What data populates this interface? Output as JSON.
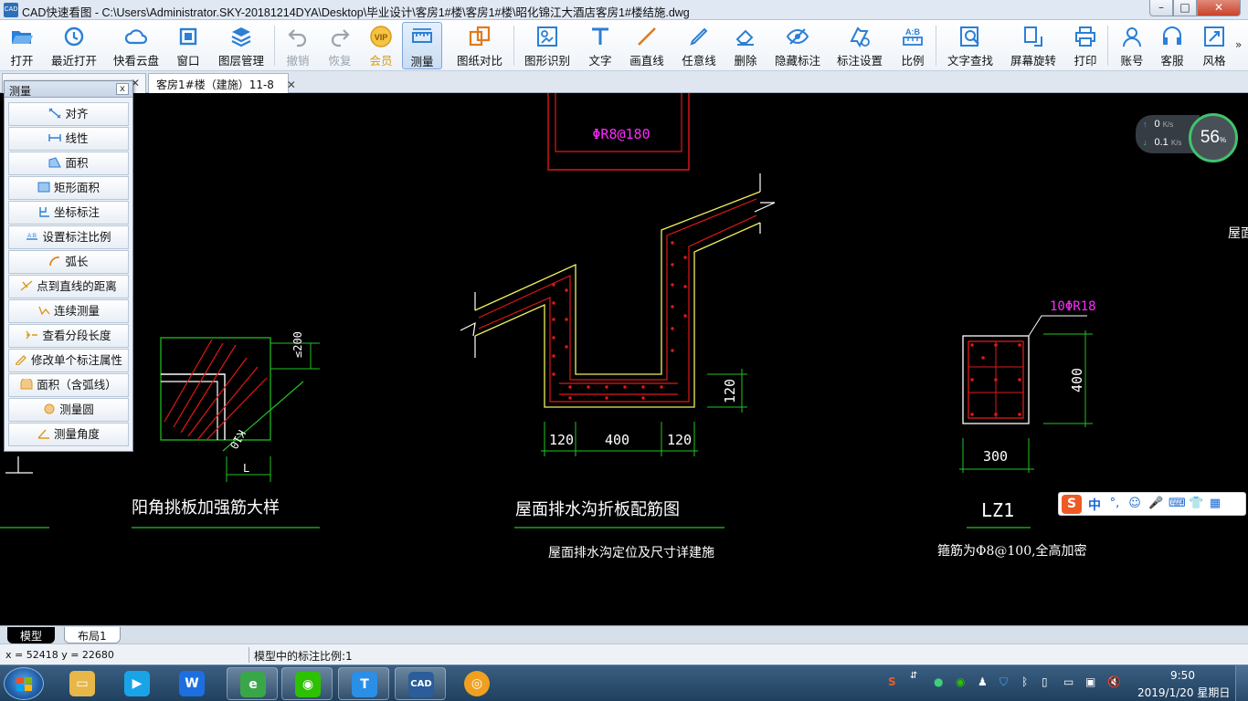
{
  "window": {
    "title": "CAD快速看图 - C:\\Users\\Administrator.SKY-20181214DYA\\Desktop\\毕业设计\\客房1#楼\\客房1#楼\\昭化锦江大酒店客房1#楼结施.dwg",
    "app_icon": "CAD",
    "minimize": "–",
    "maximize": "□",
    "close": "✕"
  },
  "toolbar": {
    "items": [
      {
        "label": "打开",
        "icon": "folder-open-icon",
        "color": "#2b7fd6"
      },
      {
        "label": "最近打开",
        "icon": "history-icon",
        "color": "#2b7fd6"
      },
      {
        "label": "快看云盘",
        "icon": "cloud-icon",
        "color": "#2b7fd6"
      },
      {
        "label": "窗口",
        "icon": "window-icon",
        "color": "#2b7fd6"
      },
      {
        "label": "图层管理",
        "icon": "layers-icon",
        "color": "#2b7fd6"
      },
      {
        "label": "撤销",
        "icon": "undo-icon",
        "color": "#9aa3ad"
      },
      {
        "label": "恢复",
        "icon": "redo-icon",
        "color": "#9aa3ad"
      },
      {
        "label": "会员",
        "icon": "vip-icon",
        "color": "#d99a1c"
      },
      {
        "label": "测量",
        "icon": "ruler-icon",
        "color": "#2b7fd6"
      },
      {
        "label": "图纸对比",
        "icon": "compare-icon",
        "color": "#e07b1a"
      },
      {
        "label": "图形识别",
        "icon": "shape-recognize-icon",
        "color": "#2b7fd6"
      },
      {
        "label": "文字",
        "icon": "text-icon",
        "color": "#2b7fd6"
      },
      {
        "label": "画直线",
        "icon": "line-icon",
        "color": "#e07b1a"
      },
      {
        "label": "任意线",
        "icon": "pen-icon",
        "color": "#2b7fd6"
      },
      {
        "label": "删除",
        "icon": "eraser-icon",
        "color": "#2b7fd6"
      },
      {
        "label": "隐藏标注",
        "icon": "hide-eye-icon",
        "color": "#2b7fd6"
      },
      {
        "label": "标注设置",
        "icon": "annotation-settings-icon",
        "color": "#2b7fd6"
      },
      {
        "label": "比例",
        "icon": "scale-icon",
        "color": "#2b7fd6"
      },
      {
        "label": "文字查找",
        "icon": "text-search-icon",
        "color": "#2b7fd6"
      },
      {
        "label": "屏幕旋转",
        "icon": "rotate-screen-icon",
        "color": "#2b7fd6"
      },
      {
        "label": "打印",
        "icon": "printer-icon",
        "color": "#2b7fd6"
      },
      {
        "label": "账号",
        "icon": "user-icon",
        "color": "#2b7fd6"
      },
      {
        "label": "客服",
        "icon": "headset-icon",
        "color": "#2b7fd6"
      },
      {
        "label": "风格",
        "icon": "style-icon",
        "color": "#2b7fd6"
      }
    ],
    "more": "»"
  },
  "doc_tabs": [
    {
      "label": "",
      "close": "✕"
    },
    {
      "label": "客房1#楼（建施）11-8",
      "close": "✕"
    }
  ],
  "measure_panel": {
    "title": "测量",
    "close": "x",
    "items": [
      {
        "label": "对齐",
        "icon": "align-measure-icon"
      },
      {
        "label": "线性",
        "icon": "linear-measure-icon"
      },
      {
        "label": "面积",
        "icon": "area-icon"
      },
      {
        "label": "矩形面积",
        "icon": "rect-area-icon"
      },
      {
        "label": "坐标标注",
        "icon": "coordinate-icon"
      },
      {
        "label": "设置标注比例",
        "icon": "set-scale-icon"
      },
      {
        "label": "弧长",
        "icon": "arc-length-icon"
      },
      {
        "label": "点到直线的距离",
        "icon": "point-line-distance-icon"
      },
      {
        "label": "连续测量",
        "icon": "continuous-measure-icon"
      },
      {
        "label": "查看分段长度",
        "icon": "segment-length-icon"
      },
      {
        "label": "修改单个标注属性",
        "icon": "edit-annotation-icon"
      },
      {
        "label": "面积（含弧线）",
        "icon": "arc-area-icon"
      },
      {
        "label": "测量圆",
        "icon": "circle-measure-icon"
      },
      {
        "label": "测量角度",
        "icon": "angle-measure-icon"
      }
    ]
  },
  "drawing": {
    "top_rebar_label": "ΦR8@180",
    "detail1_title": "阳角挑板加强筋大样",
    "detail1_dim_200": "≤200",
    "detail1_label_k": "K10",
    "detail1_dim_l": "L",
    "detail2_title": "屋面排水沟折板配筋图",
    "detail2_subtitle": "屋面排水沟定位及尺寸详建施",
    "detail2_dims": [
      "120",
      "400",
      "120"
    ],
    "detail2_dim_v": "120",
    "lz1_title": "LZ1",
    "lz1_rebar": "10ΦR18",
    "lz1_width": "300",
    "lz1_height": "400",
    "lz1_note": "箍筋为Φ8@100,全高加密",
    "right_edge_text": "屋面"
  },
  "network": {
    "upload": "0",
    "upload_unit": "K/s",
    "download": "0.1",
    "download_unit": "K/s",
    "percent": "56",
    "percent_sign": "%"
  },
  "ime": {
    "logo": "S",
    "lang": "中",
    "punct": "°,",
    "emoji": "☺",
    "mic": "🎤",
    "keyboard": "⌨",
    "skin": "👕",
    "grid": "▦"
  },
  "model_tabs": [
    {
      "label": "模型",
      "active": true
    },
    {
      "label": "布局1",
      "active": false
    }
  ],
  "statusbar": {
    "coords": "x = 52418  y = 22680",
    "scale": "模型中的标注比例:1"
  },
  "taskbar": {
    "apps": [
      {
        "name": "explorer",
        "icon": "folder-icon",
        "color": "#e7b74a",
        "glyph": "▭"
      },
      {
        "name": "video",
        "icon": "video-player-icon",
        "color": "#1aa4e8",
        "glyph": "▶"
      },
      {
        "name": "wps",
        "icon": "wps-icon",
        "color": "#1d6fe0",
        "glyph": "W"
      },
      {
        "name": "ie",
        "icon": "browser-icon",
        "color": "#3aa64a",
        "glyph": "e"
      },
      {
        "name": "wechat",
        "icon": "wechat-icon",
        "color": "#2dc100",
        "glyph": "◉"
      },
      {
        "name": "t-app",
        "icon": "t-app-icon",
        "color": "#2b8fe6",
        "glyph": "T"
      },
      {
        "name": "cad",
        "icon": "cad-icon",
        "color": "#2a5d9a",
        "glyph": "CAD"
      },
      {
        "name": "ball",
        "icon": "orange-ball-icon",
        "color": "#f0a020",
        "glyph": "◎"
      }
    ],
    "clock_time": "9:50",
    "clock_date": "2019/1/20 星期日"
  }
}
